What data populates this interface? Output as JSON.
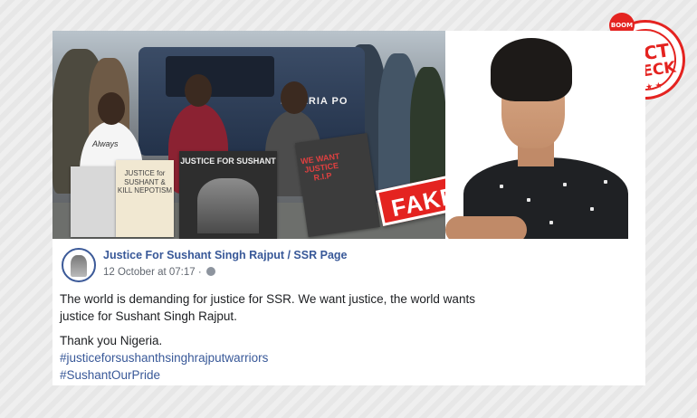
{
  "post": {
    "page_name": "Justice For Sushant Singh Rajput / SSR Page",
    "timestamp": "12 October at 07:17 · ",
    "privacy_icon": "globe-icon",
    "paragraph_1": "The world is demanding for justice for SSR. We want justice, the world wants justice for Sushant Singh Rajput.",
    "paragraph_2": "Thank you Nigeria.",
    "hashtags": [
      "#justiceforsushanthsinghrajputwarriors",
      "#SushantOurPride"
    ],
    "link_color": "#385898"
  },
  "image": {
    "fake_label": "FAKE",
    "truck_text": "NIGERIA PO",
    "signs": {
      "sign_1": "JUSTICE for SUSHANT & KILL NEPOTISM",
      "sign_2": "JUSTICE FOR SUSHANT",
      "sign_3": "WE WANT JUSTICE R.I.P",
      "shirt": "Always"
    }
  },
  "seal": {
    "brand": "BOOM",
    "line_1": "FACT",
    "line_2": "CHECK",
    "stars": "★ ★ ★",
    "accent_color": "#e42320"
  }
}
